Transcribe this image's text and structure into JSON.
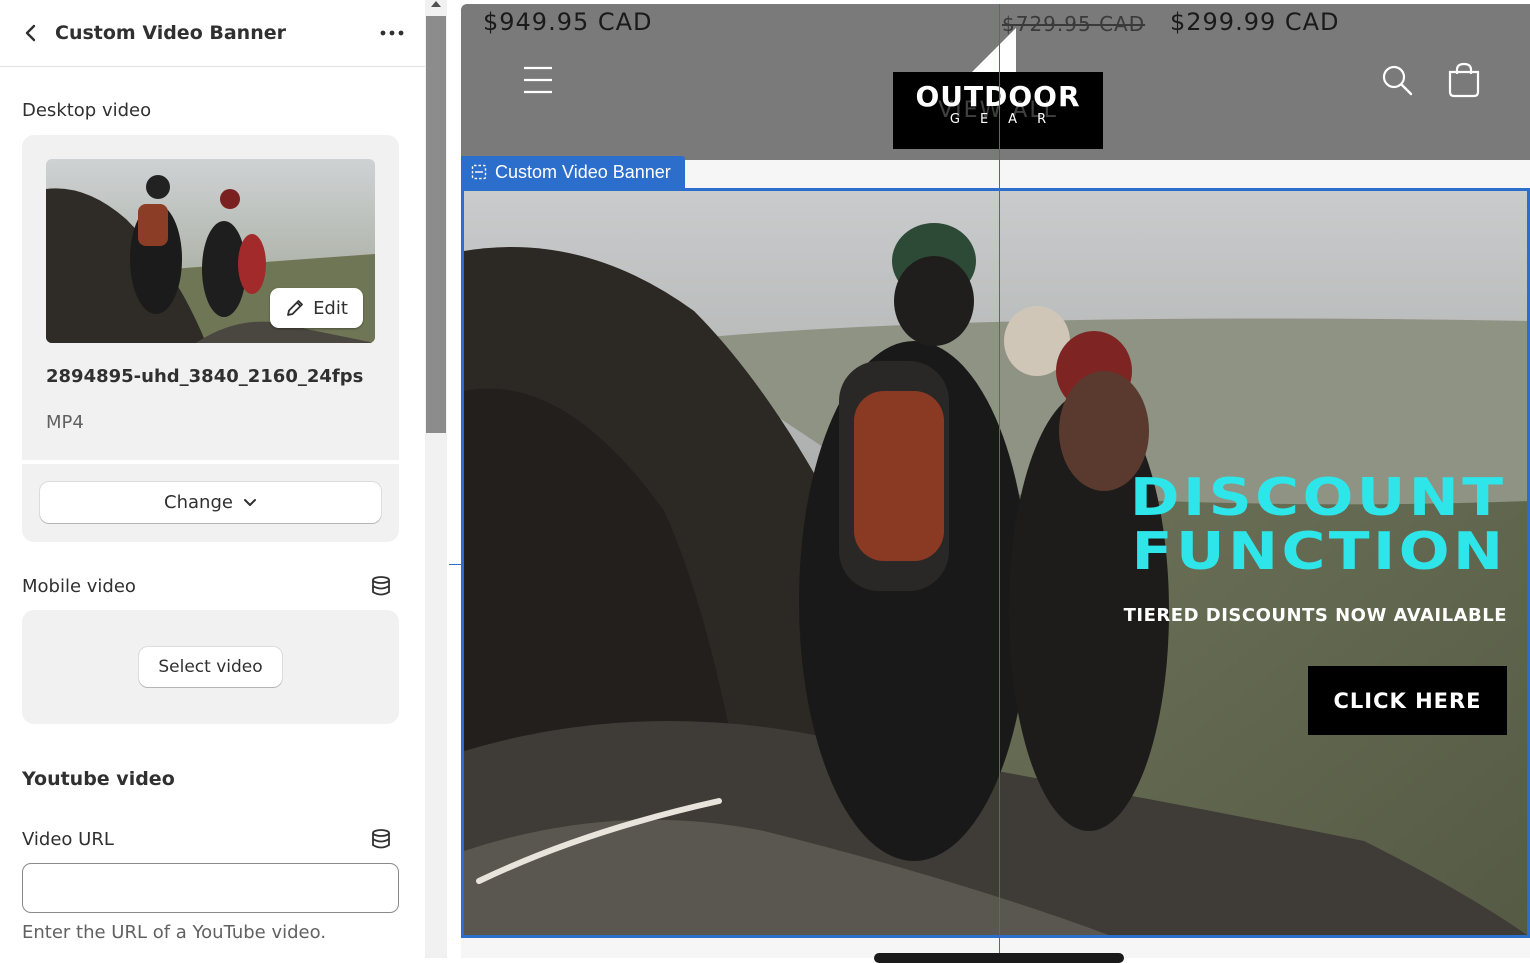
{
  "panel": {
    "title": "Custom Video Banner",
    "desktop_video": {
      "label": "Desktop video",
      "edit_label": "Edit",
      "file_name": "2894895-uhd_3840_2160_24fps",
      "file_type": "MP4",
      "change_label": "Change"
    },
    "mobile_video": {
      "label": "Mobile video",
      "select_label": "Select video"
    },
    "youtube": {
      "heading": "Youtube video",
      "url_label": "Video URL",
      "url_value": "",
      "help_text": "Enter the URL of a YouTube video."
    }
  },
  "preview": {
    "prices": [
      "$949.95 CAD",
      "$729.95 CAD",
      "$299.99 CAD"
    ],
    "logo": {
      "word": "OUTDOOR",
      "sub": "GEAR",
      "ghost_text": "VIEW ALL"
    },
    "section_tag": "Custom Video Banner",
    "banner": {
      "headline_line1": "DISCOUNT",
      "headline_line2": "FUNCTION",
      "subline": "TIERED DISCOUNTS NOW AVAILABLE",
      "cta": "CLICK HERE"
    }
  },
  "colors": {
    "accent": "#2c6ecb",
    "headline": "#2ee6ea",
    "header_bg": "#7a7a7a"
  },
  "icons": [
    "chevron-left-icon",
    "more-horizontal-icon",
    "pencil-icon",
    "chevron-down-icon",
    "database-icon",
    "menu-icon",
    "search-icon",
    "cart-icon",
    "section-icon"
  ]
}
